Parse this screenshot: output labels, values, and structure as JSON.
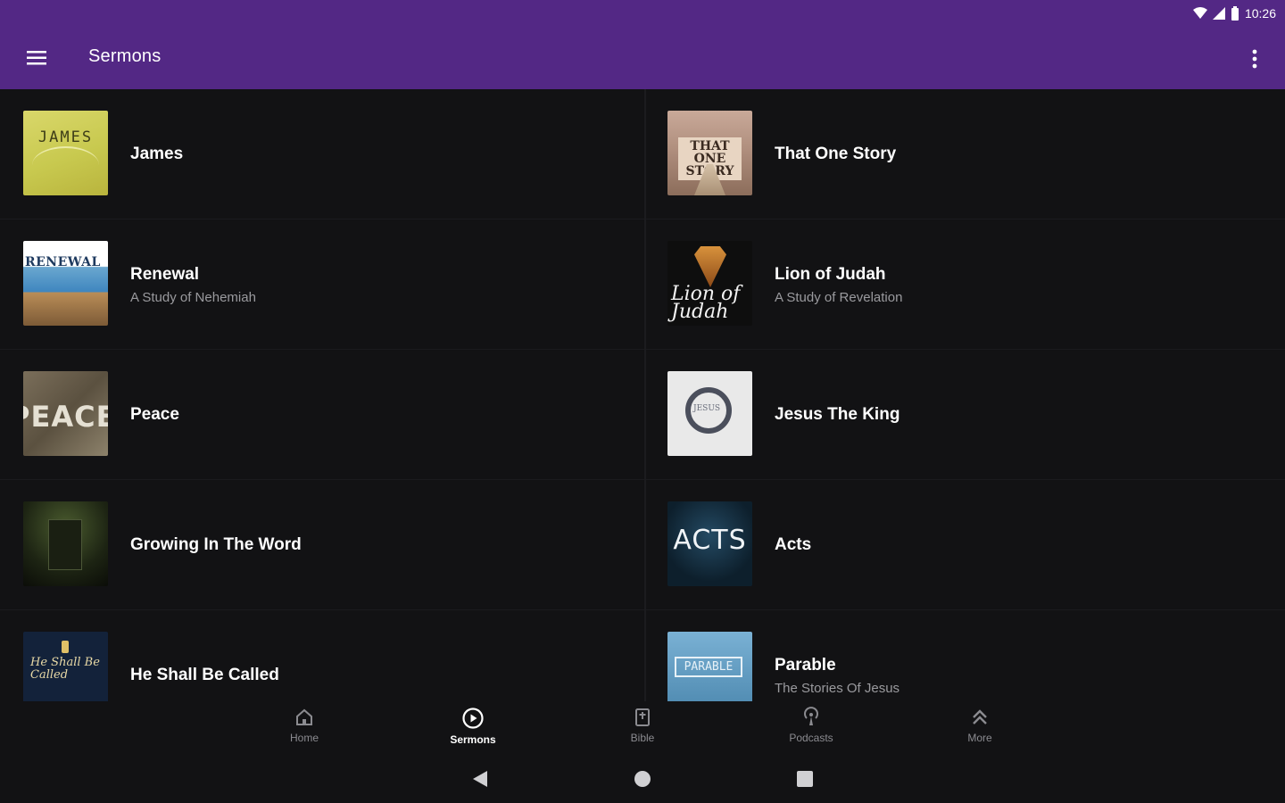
{
  "status_bar": {
    "time": "10:26"
  },
  "app_bar": {
    "title": "Sermons"
  },
  "sermons_left": [
    {
      "title": "James",
      "subtitle": "",
      "thumb_text": "JAMES"
    },
    {
      "title": "Renewal",
      "subtitle": "A Study of Nehemiah",
      "thumb_text": "RENEWAL"
    },
    {
      "title": "Peace",
      "subtitle": "",
      "thumb_text": "PEACE"
    },
    {
      "title": "Growing In The Word",
      "subtitle": "",
      "thumb_text": ""
    },
    {
      "title": "He Shall Be Called",
      "subtitle": "",
      "thumb_text": "He Shall Be Called"
    }
  ],
  "sermons_right": [
    {
      "title": "That One Story",
      "subtitle": "",
      "thumb_text": "THAT ONE STORY"
    },
    {
      "title": "Lion of Judah",
      "subtitle": "A Study of Revelation",
      "thumb_text": "Lion of Judah"
    },
    {
      "title": "Jesus The King",
      "subtitle": "",
      "thumb_text": "JESUS"
    },
    {
      "title": "Acts",
      "subtitle": "",
      "thumb_text": "ACTS"
    },
    {
      "title": "Parable",
      "subtitle": "The Stories Of Jesus",
      "thumb_text": "PARABLE"
    }
  ],
  "bottom_nav": [
    {
      "label": "Home",
      "icon": "home-icon"
    },
    {
      "label": "Sermons",
      "icon": "play-circle-icon",
      "active": true
    },
    {
      "label": "Bible",
      "icon": "bible-icon"
    },
    {
      "label": "Podcasts",
      "icon": "podcast-icon"
    },
    {
      "label": "More",
      "icon": "chevron-up-double-icon"
    }
  ],
  "colors": {
    "accent": "#532885",
    "background": "#121214"
  }
}
